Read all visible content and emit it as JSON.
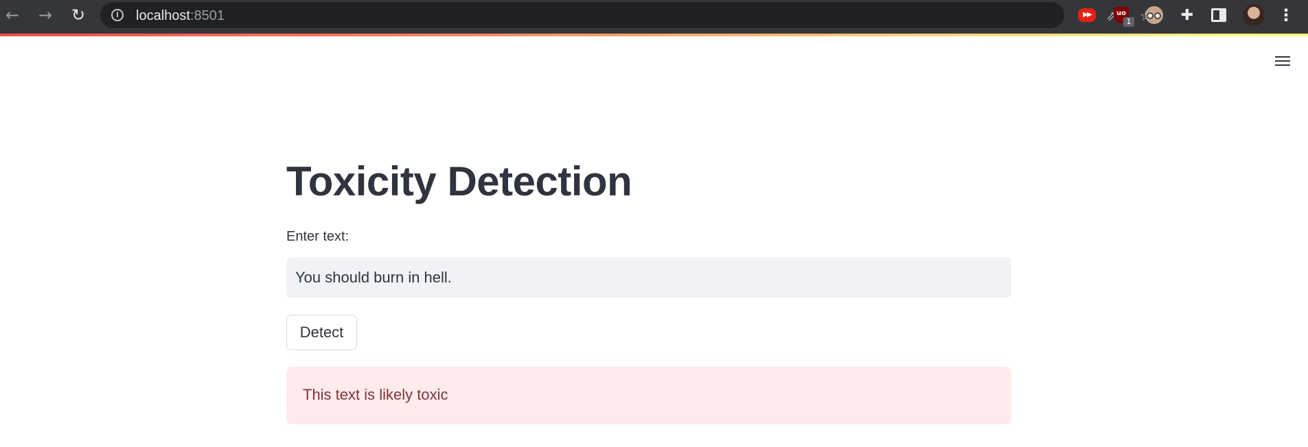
{
  "browser": {
    "url_host": "localhost",
    "url_port": ":8501",
    "nav": {
      "back": "←",
      "forward": "→",
      "reload": "↻"
    },
    "icons": [
      "info-icon",
      "share-icon",
      "star-icon",
      "youtube-ext-icon",
      "ublock-ext-icon",
      "eyes-ext-icon",
      "puzzle-icon",
      "side-panel-icon",
      "profile-avatar",
      "more-menu-icon"
    ],
    "ublock_badge": "1",
    "youtube_ext_glyph": "▶▶",
    "ublock_glyph": "uo",
    "share_glyph": "⇗",
    "star_glyph": "☆",
    "puzzle_glyph": "✚",
    "menu_glyph": "⋮",
    "info_glyph": "i"
  },
  "app": {
    "title": "Toxicity Detection",
    "input_label": "Enter text:",
    "input_value": "You should burn in hell.",
    "button_label": "Detect",
    "result_text": "This text is likely toxic",
    "colors": {
      "title": "#31333f",
      "input_bg": "#f0f2f6",
      "alert_bg": "#ffebec",
      "alert_text": "#7d353b",
      "accent_gradient_start": "#ff4b4b",
      "accent_gradient_end": "#fffd80"
    }
  }
}
